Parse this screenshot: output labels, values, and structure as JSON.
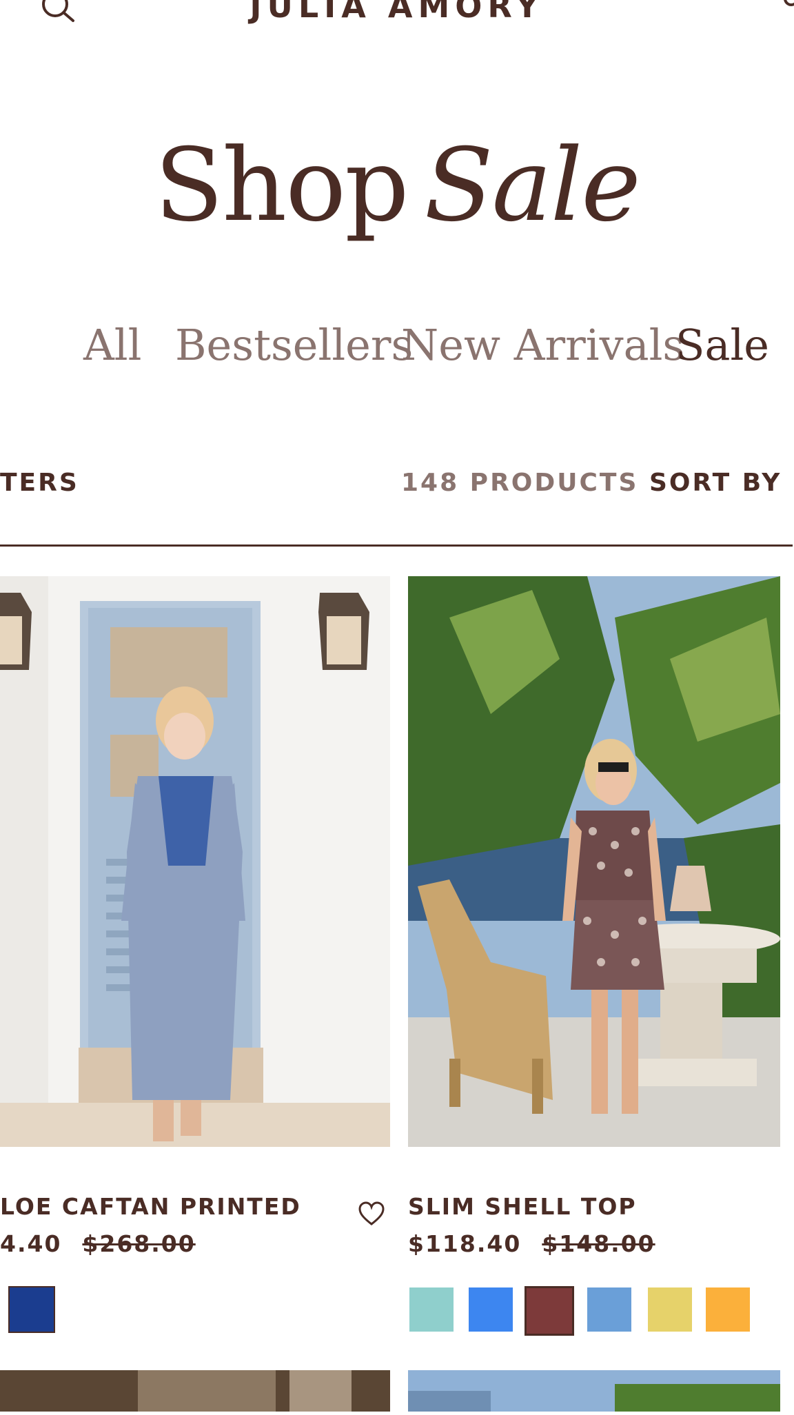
{
  "header": {
    "brand": "JULIA AMORY",
    "search_icon": "search-icon",
    "cart_icon": "cart-icon"
  },
  "page": {
    "title_word1": "Shop",
    "title_word2": "Sale"
  },
  "tabs": [
    {
      "label": "All",
      "active": false
    },
    {
      "label": "Bestsellers",
      "active": false
    },
    {
      "label": "New Arrivals",
      "active": false
    },
    {
      "label": "Sale",
      "active": true
    }
  ],
  "toolbar": {
    "filters_label": "TERS",
    "product_count": "148 PRODUCTS",
    "sort_label": "SORT BY"
  },
  "products": [
    {
      "name": "LOE CAFTAN PRINTED",
      "price": "4.40",
      "was_price": "$268.00",
      "wishlist_icon": "heart-icon",
      "swatches": [
        "#1b3d8f"
      ]
    },
    {
      "name": "SLIM SHELL TOP",
      "price": "$118.40",
      "was_price": "$148.00",
      "swatches": [
        "#8fcfcc",
        "#3d86f0",
        "#7d3a3a",
        "#6a9fd8",
        "#e6d26a",
        "#fbb03b"
      ],
      "selected_swatch": 2
    }
  ],
  "colors": {
    "brand_text": "#4a2c25",
    "muted_text": "#8a746f",
    "background": "#ffffff"
  }
}
